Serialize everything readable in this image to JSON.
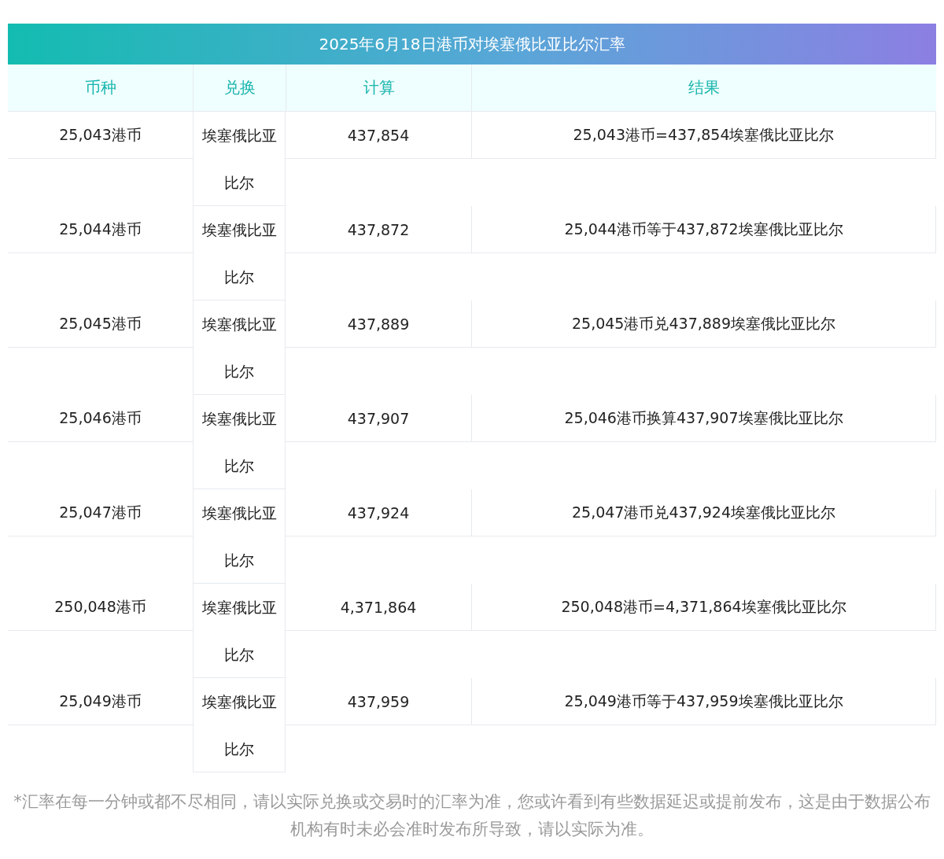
{
  "title": "2025年6月18日港币对埃塞俄比亚比尔汇率",
  "columns": [
    "币种",
    "兑换",
    "计算",
    "结果"
  ],
  "rows": [
    {
      "currency": "25,043港币",
      "target": "埃塞俄比亚比尔",
      "amount": "437,854",
      "result": "25,043港币=437,854埃塞俄比亚比尔"
    },
    {
      "currency": "25,044港币",
      "target": "埃塞俄比亚比尔",
      "amount": "437,872",
      "result": "25,044港币等于437,872埃塞俄比亚比尔"
    },
    {
      "currency": "25,045港币",
      "target": "埃塞俄比亚比尔",
      "amount": "437,889",
      "result": "25,045港币兑437,889埃塞俄比亚比尔"
    },
    {
      "currency": "25,046港币",
      "target": "埃塞俄比亚比尔",
      "amount": "437,907",
      "result": "25,046港币换算437,907埃塞俄比亚比尔"
    },
    {
      "currency": "25,047港币",
      "target": "埃塞俄比亚比尔",
      "amount": "437,924",
      "result": "25,047港币兑437,924埃塞俄比亚比尔"
    },
    {
      "currency": "250,048港币",
      "target": "埃塞俄比亚比尔",
      "amount": "4,371,864",
      "result": "250,048港币=4,371,864埃塞俄比亚比尔"
    },
    {
      "currency": "25,049港币",
      "target": "埃塞俄比亚比尔",
      "amount": "437,959",
      "result": "25,049港币等于437,959埃塞俄比亚比尔"
    }
  ],
  "footnote": "*汇率在每一分钟或都不尽相同，请以实际兑换或交易时的汇率为准，您或许看到有些数据延迟或提前发布，这是由于数据公布机构有时未必会准时发布所导致，请以实际为准。"
}
